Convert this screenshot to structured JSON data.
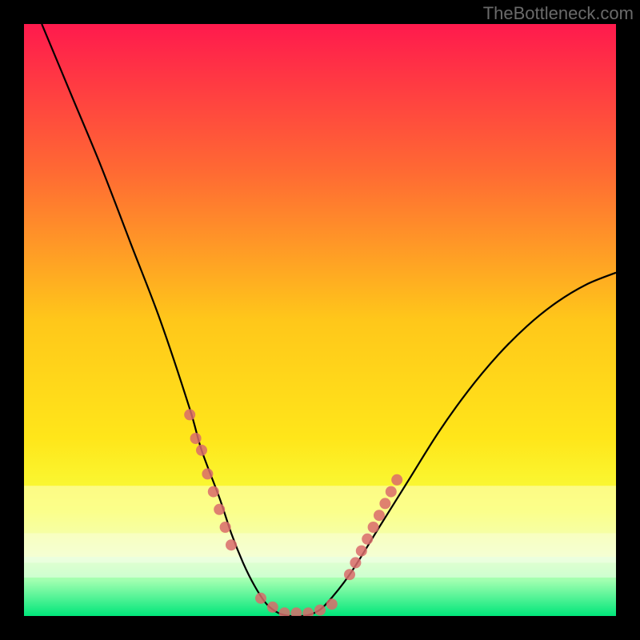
{
  "watermark": "TheBottleneck.com",
  "chart_data": {
    "type": "line",
    "title": "",
    "xlabel": "",
    "ylabel": "",
    "xlim": [
      0,
      100
    ],
    "ylim": [
      0,
      100
    ],
    "grid": false,
    "legend": false,
    "series": [
      {
        "name": "bottleneck-curve",
        "x": [
          3,
          8,
          13,
          18,
          23,
          28,
          30,
          33,
          35,
          37,
          39,
          41,
          43,
          45,
          47,
          49,
          51,
          55,
          60,
          65,
          70,
          75,
          80,
          85,
          90,
          95,
          100
        ],
        "y": [
          100,
          88,
          76,
          63,
          50,
          35,
          28,
          20,
          14,
          9,
          5,
          2,
          0.5,
          0,
          0,
          0.5,
          2,
          7,
          15,
          23,
          31,
          38,
          44,
          49,
          53,
          56,
          58
        ],
        "color": "#000000"
      }
    ],
    "marker_clusters": [
      {
        "name": "left-cluster",
        "points_xy": [
          [
            28,
            34
          ],
          [
            29,
            30
          ],
          [
            30,
            28
          ],
          [
            31,
            24
          ],
          [
            32,
            21
          ],
          [
            33,
            18
          ],
          [
            34,
            15
          ],
          [
            35,
            12
          ]
        ],
        "color": "#d96b6b"
      },
      {
        "name": "bottom-cluster",
        "points_xy": [
          [
            40,
            3
          ],
          [
            42,
            1.5
          ],
          [
            44,
            0.5
          ],
          [
            46,
            0.5
          ],
          [
            48,
            0.5
          ],
          [
            50,
            1
          ],
          [
            52,
            2
          ]
        ],
        "color": "#d96b6b"
      },
      {
        "name": "right-cluster",
        "points_xy": [
          [
            55,
            7
          ],
          [
            56,
            9
          ],
          [
            57,
            11
          ],
          [
            58,
            13
          ],
          [
            59,
            15
          ],
          [
            60,
            17
          ],
          [
            61,
            19
          ],
          [
            62,
            21
          ],
          [
            63,
            23
          ]
        ],
        "color": "#d96b6b"
      }
    ],
    "background_gradient": {
      "type": "vertical",
      "stops": [
        [
          0.0,
          "#ff1a4d"
        ],
        [
          0.25,
          "#ff6a33"
        ],
        [
          0.5,
          "#ffc71a"
        ],
        [
          0.7,
          "#ffe61a"
        ],
        [
          0.82,
          "#f7ff3d"
        ],
        [
          0.9,
          "#e0ffb0"
        ],
        [
          0.94,
          "#a0ffb0"
        ],
        [
          1.0,
          "#00e67a"
        ]
      ]
    }
  }
}
